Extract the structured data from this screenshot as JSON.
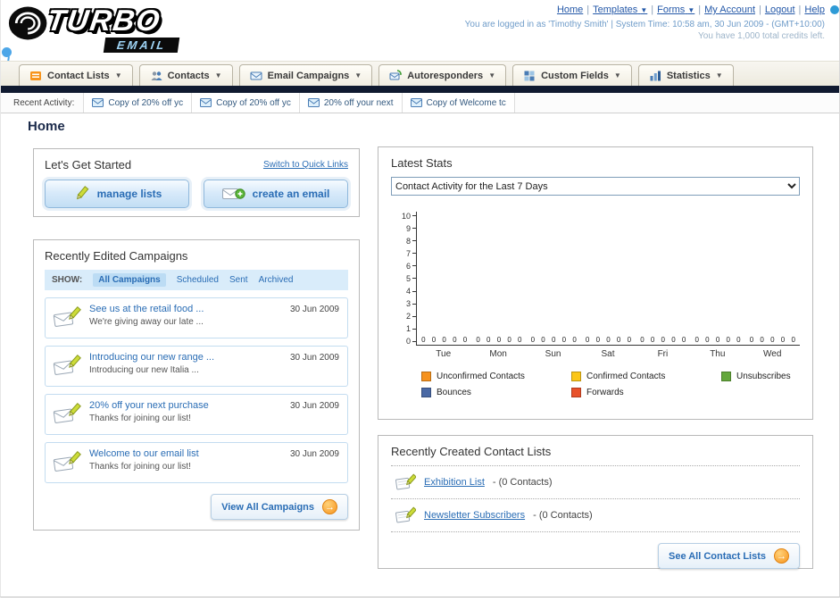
{
  "header": {
    "logo_title": "TURBO",
    "logo_subtitle": "EMAIL",
    "links": [
      "Home",
      "Templates",
      "Forms",
      "My Account",
      "Logout",
      "Help"
    ],
    "login_info": "You are logged in as 'Timothy Smith' | System Time: 10:58 am, 30 Jun 2009 - (GMT+10:00)",
    "credits": "You have 1,000 total credits left."
  },
  "nav": {
    "items": [
      {
        "label": "Contact Lists"
      },
      {
        "label": "Contacts"
      },
      {
        "label": "Email Campaigns"
      },
      {
        "label": "Autoresponders"
      },
      {
        "label": "Custom Fields"
      },
      {
        "label": "Statistics"
      }
    ]
  },
  "recent_activity": {
    "label": "Recent Activity:",
    "items": [
      "Copy of 20% off yc",
      "Copy of 20% off yc",
      "20% off your next",
      "Copy of Welcome tc"
    ]
  },
  "page": {
    "title": "Home"
  },
  "get_started": {
    "title": "Let's Get Started",
    "switch_link": "Switch to Quick Links",
    "manage_lists": "manage lists",
    "create_email": "create an email"
  },
  "campaigns": {
    "title": "Recently Edited Campaigns",
    "show_label": "SHOW:",
    "tabs": [
      "All Campaigns",
      "Scheduled",
      "Sent",
      "Archived"
    ],
    "items": [
      {
        "title": "See us at the retail food ...",
        "subtitle": "We're giving away our late ...",
        "date": "30 Jun 2009"
      },
      {
        "title": "Introducing our new range ...",
        "subtitle": "Introducing our new Italia ...",
        "date": "30 Jun 2009"
      },
      {
        "title": "20% off your next purchase",
        "subtitle": "Thanks for joining our list!",
        "date": "30 Jun 2009"
      },
      {
        "title": "Welcome to our email list",
        "subtitle": "Thanks for joining our list!",
        "date": "30 Jun 2009"
      }
    ],
    "view_all_label": "View All Campaigns"
  },
  "stats": {
    "title": "Latest Stats",
    "selected_option": "Contact Activity for the Last 7 Days",
    "chart_data": {
      "type": "bar",
      "title": "Contact Activity for the Last 7 Days",
      "categories": [
        "Tue",
        "Mon",
        "Sun",
        "Sat",
        "Fri",
        "Thu",
        "Wed"
      ],
      "series": [
        {
          "name": "Unconfirmed Contacts",
          "color": "#f6921e",
          "values": [
            0,
            0,
            0,
            0,
            0,
            0,
            0
          ]
        },
        {
          "name": "Confirmed Contacts",
          "color": "#fbc618",
          "values": [
            0,
            0,
            0,
            0,
            0,
            0,
            0
          ]
        },
        {
          "name": "Unsubscribes",
          "color": "#64a83c",
          "values": [
            0,
            0,
            0,
            0,
            0,
            0,
            0
          ]
        },
        {
          "name": "Bounces",
          "color": "#4a69a5",
          "values": [
            0,
            0,
            0,
            0,
            0,
            0,
            0
          ]
        },
        {
          "name": "Forwards",
          "color": "#e8512a",
          "values": [
            0,
            0,
            0,
            0,
            0,
            0,
            0
          ]
        }
      ],
      "ylim": [
        0,
        10
      ],
      "legend_position": "bottom",
      "grid": false
    }
  },
  "contact_lists": {
    "title": "Recently Created Contact Lists",
    "items": [
      {
        "name": "Exhibition List",
        "suffix": " - (0 Contacts)"
      },
      {
        "name": "Newsletter Subscribers",
        "suffix": " - (0 Contacts)"
      }
    ],
    "see_all_label": "See All Contact Lists"
  }
}
